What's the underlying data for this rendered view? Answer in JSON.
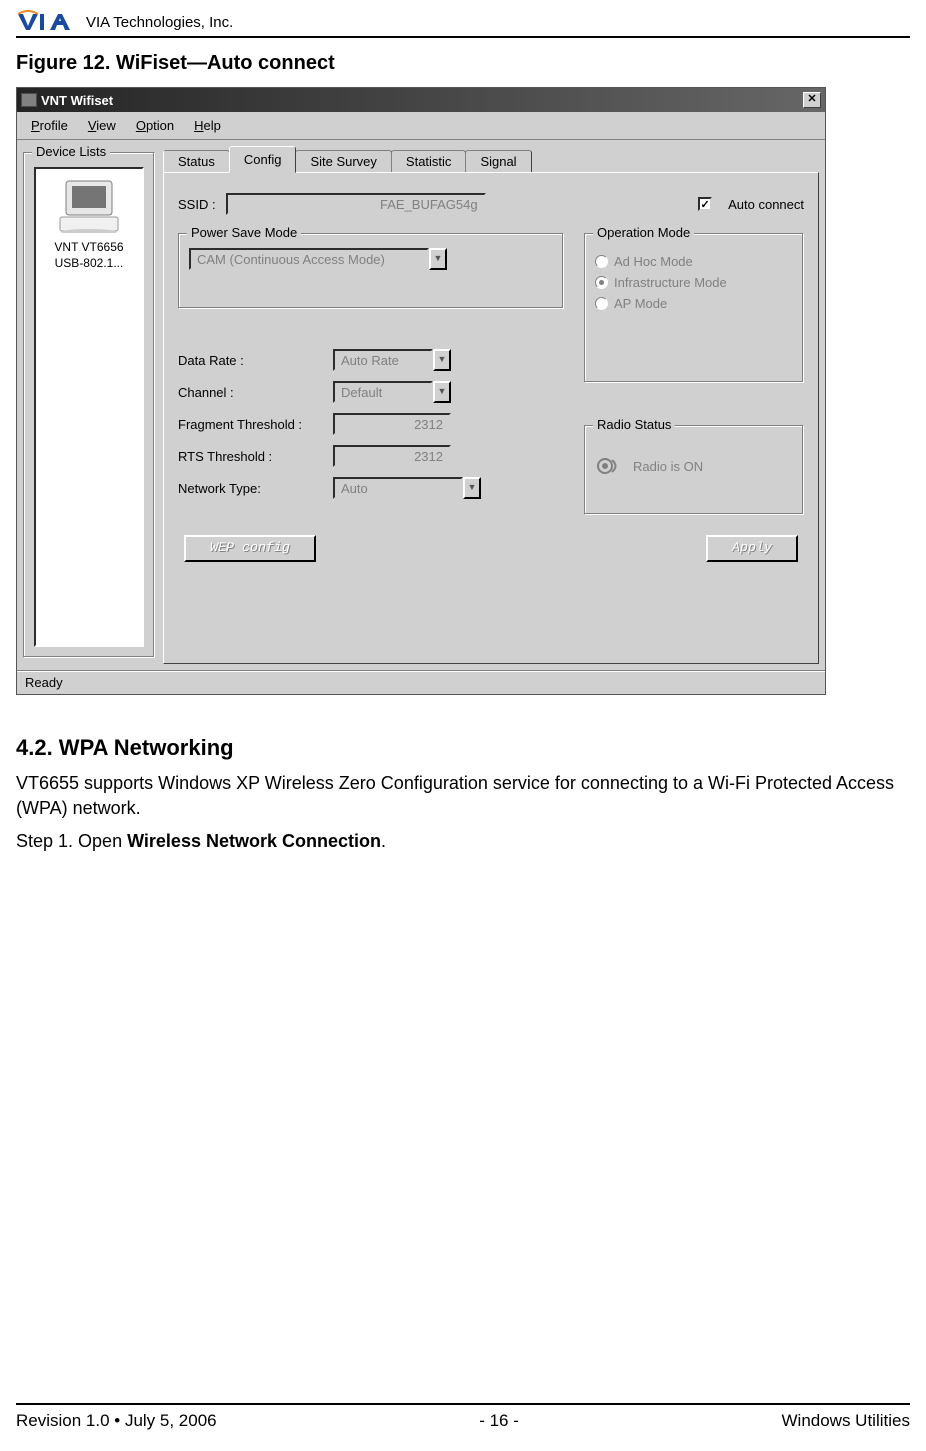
{
  "header": {
    "company": "VIA Technologies, Inc."
  },
  "figure_caption": "Figure 12. WiFiset—Auto connect",
  "window": {
    "title": "VNT Wifiset",
    "menu": {
      "profile": "Profile",
      "view": "View",
      "option": "Option",
      "help": "Help"
    },
    "device_lists": {
      "legend": "Device Lists",
      "item_line1": "VNT VT6656",
      "item_line2": "USB-802.1..."
    },
    "tabs": {
      "status": "Status",
      "config": "Config",
      "site_survey": "Site Survey",
      "statistic": "Statistic",
      "signal": "Signal"
    },
    "config": {
      "ssid_label": "SSID :",
      "ssid_value": "FAE_BUFAG54g",
      "auto_connect_label": "Auto connect",
      "auto_connect_checked": "✓",
      "power_save": {
        "legend": "Power Save Mode",
        "value": "CAM (Continuous Access Mode)"
      },
      "operation_mode": {
        "legend": "Operation Mode",
        "ad_hoc": "Ad Hoc Mode",
        "infrastructure": "Infrastructure Mode",
        "ap": "AP Mode"
      },
      "fields": {
        "data_rate_label": "Data Rate :",
        "data_rate_value": "Auto Rate",
        "channel_label": "Channel :",
        "channel_value": "Default",
        "fragment_label": "Fragment Threshold :",
        "fragment_value": "2312",
        "rts_label": "RTS Threshold :",
        "rts_value": "2312",
        "network_type_label": "Network Type:",
        "network_type_value": "Auto"
      },
      "radio_status": {
        "legend": "Radio Status",
        "text": "Radio is ON"
      },
      "buttons": {
        "wep": "WEP config",
        "apply": "Apply"
      }
    },
    "status_bar": "Ready"
  },
  "section": {
    "heading": "4.2. WPA Networking",
    "para1": "VT6655 supports Windows XP Wireless Zero Configuration service for connecting to a Wi-Fi Protected Access (WPA) network.",
    "step1_prefix": "Step 1. Open ",
    "step1_bold": "Wireless Network Connection",
    "step1_suffix": "."
  },
  "footer": {
    "left": "Revision 1.0 • July 5, 2006",
    "center": "- 16 -",
    "right": "Windows Utilities"
  }
}
